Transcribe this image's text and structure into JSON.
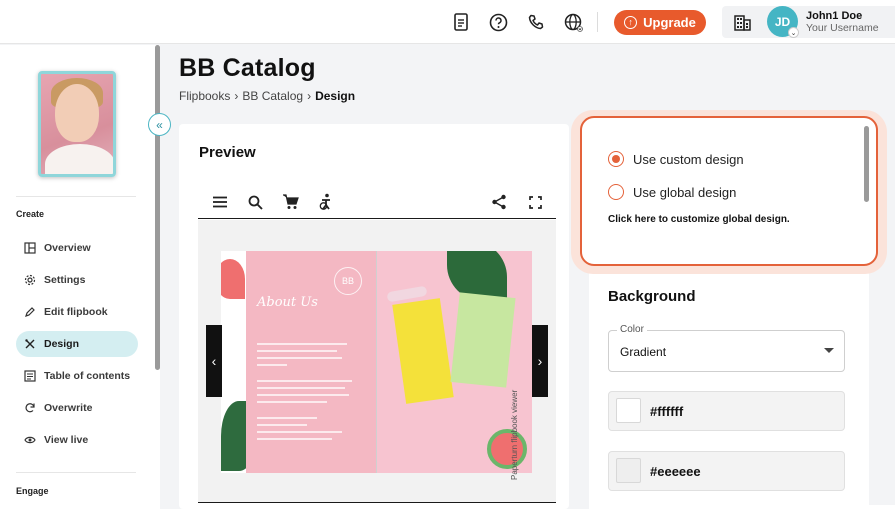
{
  "topbar": {
    "icons": [
      "document-icon",
      "help-icon",
      "phone-icon",
      "globe-icon"
    ],
    "upgrade_label": "Upgrade",
    "avatar_initials": "JD",
    "user_name": "John1 Doe",
    "user_sub": "Your Username"
  },
  "sidebar": {
    "section_create": "Create",
    "section_engage": "Engage",
    "items": [
      {
        "label": "Overview",
        "icon": "layout-icon"
      },
      {
        "label": "Settings",
        "icon": "gear-icon"
      },
      {
        "label": "Edit flipbook",
        "icon": "pencil-icon"
      },
      {
        "label": "Design",
        "icon": "design-tools-icon",
        "active": true
      },
      {
        "label": "Table of contents",
        "icon": "list-icon"
      },
      {
        "label": "Overwrite",
        "icon": "refresh-icon"
      },
      {
        "label": "View live",
        "icon": "eye-icon"
      }
    ]
  },
  "page": {
    "title": "BB Catalog",
    "breadcrumb": [
      "Flipbooks",
      "BB Catalog",
      "Design"
    ]
  },
  "preview": {
    "title": "Preview",
    "watermark": "Paperturn flipbook viewer",
    "page_heading": "About Us",
    "logo_text": "BB"
  },
  "design": {
    "options": [
      {
        "label": "Use custom design",
        "selected": true
      },
      {
        "label": "Use global design",
        "selected": false
      }
    ],
    "customize_link": "Click here to customize global design.",
    "background_title": "Background",
    "select_label": "Color",
    "select_value": "Gradient",
    "colors": [
      "#ffffff",
      "#eeeeee"
    ]
  },
  "theme": {
    "accent": "#e85a2c",
    "teal": "#45b5c4",
    "active_bg": "#d4eef1"
  }
}
